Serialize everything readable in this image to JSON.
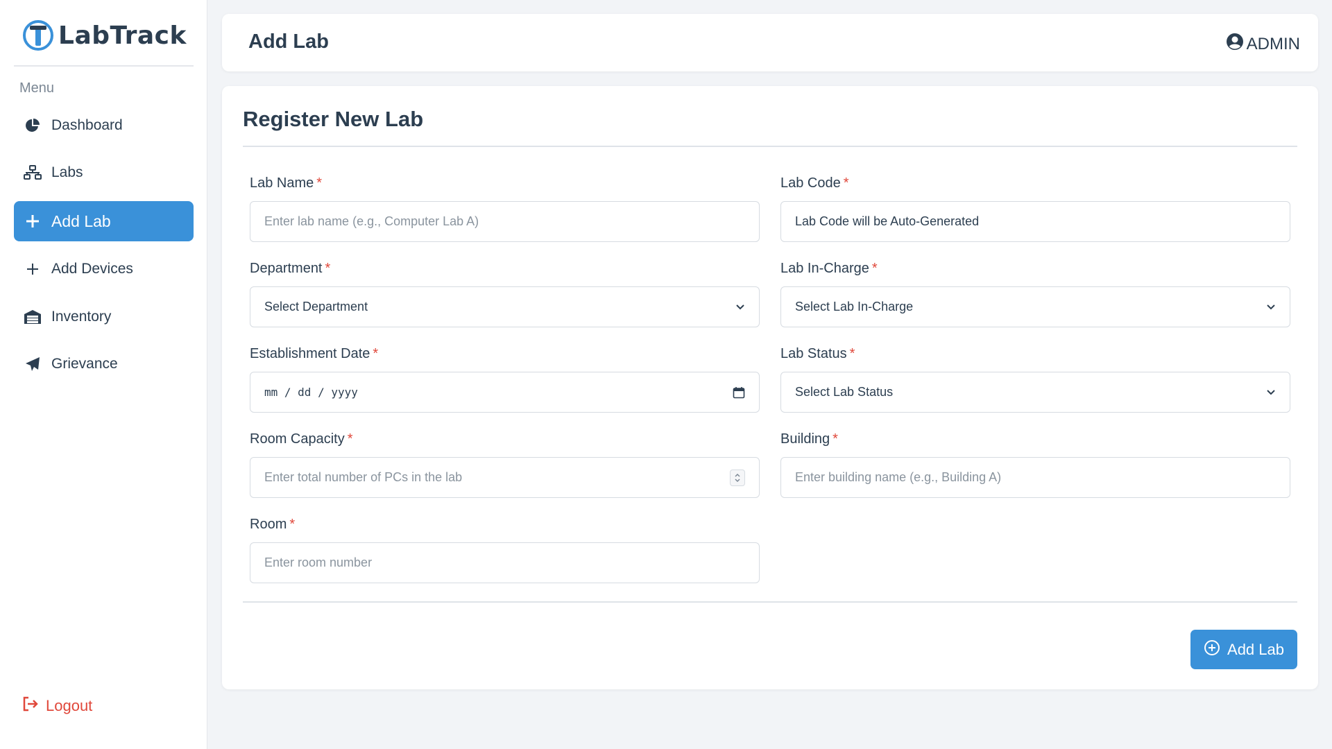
{
  "app": {
    "name": "LabTrack",
    "menu_heading": "Menu"
  },
  "sidebar": {
    "items": [
      {
        "label": "Dashboard",
        "icon": "pie-chart-icon"
      },
      {
        "label": "Labs",
        "icon": "network-icon"
      },
      {
        "label": "Add Lab",
        "icon": "plus-icon",
        "active": true
      },
      {
        "label": "Add Devices",
        "icon": "plus-icon"
      },
      {
        "label": "Inventory",
        "icon": "warehouse-icon"
      },
      {
        "label": "Grievance",
        "icon": "paper-plane-icon"
      }
    ],
    "logout_label": "Logout"
  },
  "header": {
    "title": "Add Lab",
    "user_label": "ADMIN"
  },
  "form": {
    "title": "Register New Lab",
    "required_marker": "*",
    "fields": {
      "lab_name": {
        "label": "Lab Name",
        "placeholder": "Enter lab name (e.g., Computer Lab A)"
      },
      "lab_code": {
        "label": "Lab Code",
        "value": "Lab Code will be Auto-Generated"
      },
      "department": {
        "label": "Department",
        "value": "Select Department"
      },
      "lab_incharge": {
        "label": "Lab In-Charge",
        "value": "Select Lab In-Charge"
      },
      "establishment_date": {
        "label": "Establishment Date",
        "value": "mm / dd / yyyy"
      },
      "lab_status": {
        "label": "Lab Status",
        "value": "Select Lab Status"
      },
      "room_capacity": {
        "label": "Room Capacity",
        "placeholder": "Enter total number of PCs in the lab"
      },
      "building": {
        "label": "Building",
        "placeholder": "Enter building name (e.g., Building A)"
      },
      "room": {
        "label": "Room",
        "placeholder": "Enter room number"
      }
    },
    "submit_label": "Add Lab"
  },
  "colors": {
    "accent": "#3a91d9",
    "danger": "#e0483b",
    "text": "#2c3e50",
    "background": "#f2f4f7"
  }
}
